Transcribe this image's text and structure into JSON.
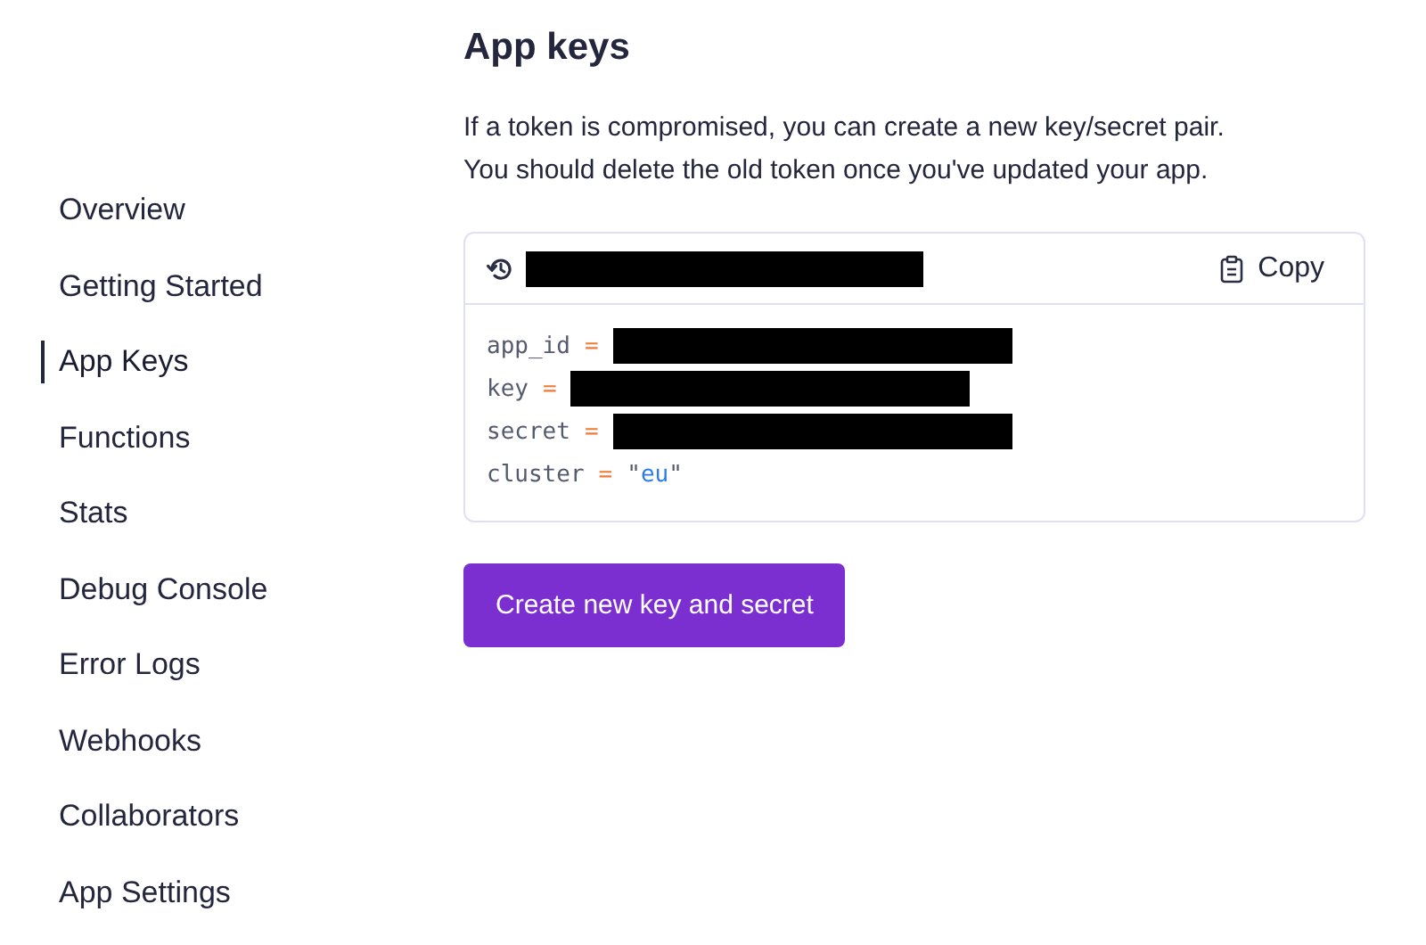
{
  "sidebar": {
    "items": [
      {
        "label": "Overview",
        "selected": false
      },
      {
        "label": "Getting Started",
        "selected": false
      },
      {
        "label": "App Keys",
        "selected": true
      },
      {
        "label": "Functions",
        "selected": false
      },
      {
        "label": "Stats",
        "selected": false
      },
      {
        "label": "Debug Console",
        "selected": false
      },
      {
        "label": "Error Logs",
        "selected": false
      },
      {
        "label": "Webhooks",
        "selected": false
      },
      {
        "label": "Collaborators",
        "selected": false
      },
      {
        "label": "App Settings",
        "selected": false
      }
    ]
  },
  "main": {
    "title": "App keys",
    "description": [
      "If a token is compromised, you can create a new key/secret pair.",
      "You should delete the old token once you've updated your app."
    ],
    "credentials": {
      "header": {
        "kind": "redacted"
      },
      "copy_label": "Copy",
      "lines": [
        {
          "key": "app_id",
          "operator": "=",
          "kind": "redacted"
        },
        {
          "key": "key",
          "operator": "=",
          "kind": "redacted"
        },
        {
          "key": "secret",
          "operator": "=",
          "kind": "redacted"
        },
        {
          "key": "cluster",
          "operator": "=",
          "kind": "string",
          "quote": "\"",
          "value": "eu"
        }
      ]
    },
    "create_button": "Create new key and secret"
  }
}
